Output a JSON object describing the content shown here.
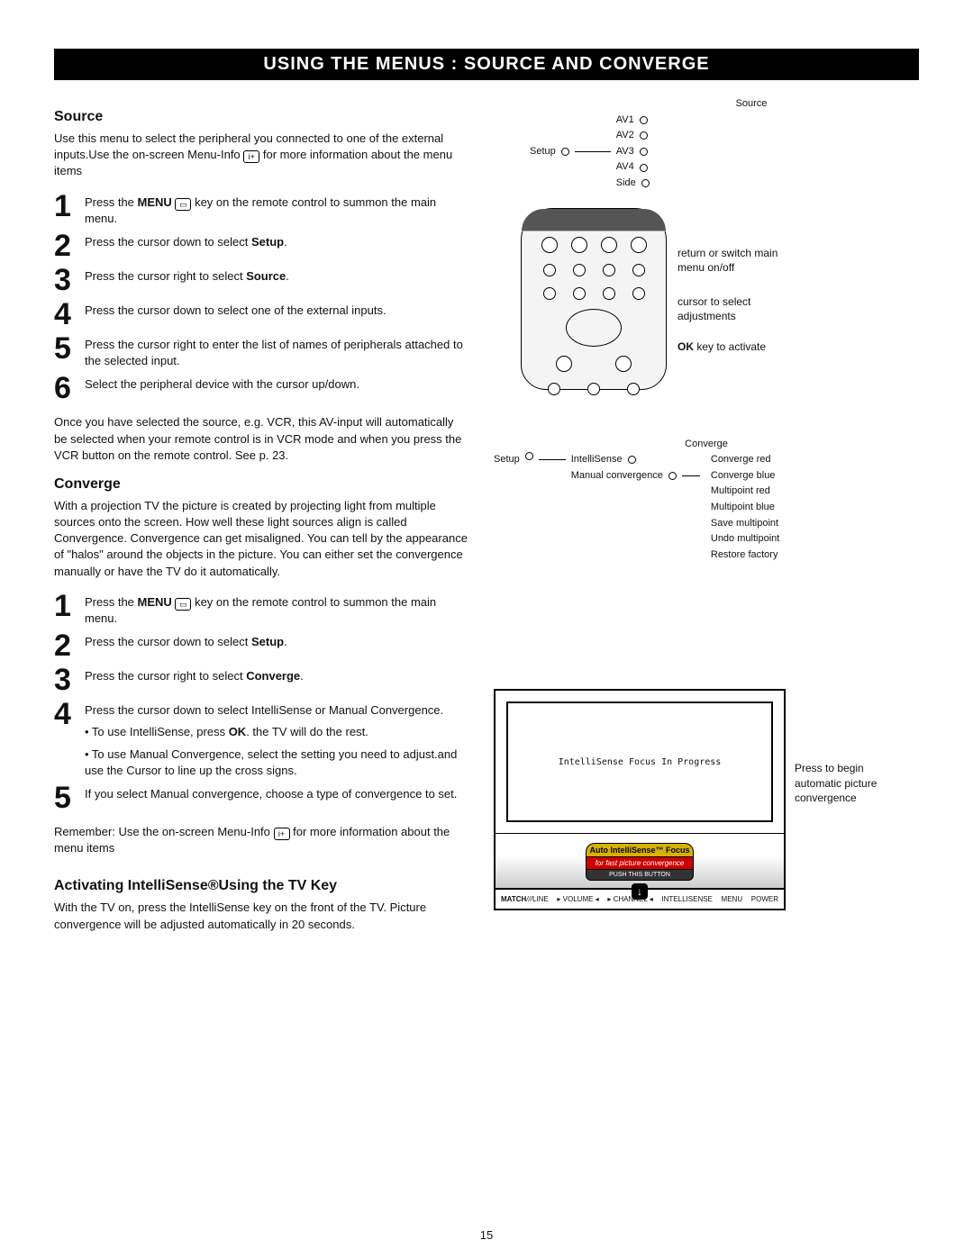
{
  "banner": "USING THE MENUS : SOURCE AND CONVERGE",
  "page_number": "15",
  "source": {
    "heading": "Source",
    "intro_a": "Use this menu  to select the peripheral you connected to one of the external inputs.Use the on-screen Menu-Info ",
    "intro_b": " for more information about the menu items",
    "info_icon": "i+",
    "menu_icon": "▭",
    "steps": [
      {
        "n": "1",
        "pre": "Press the ",
        "bold1": "MENU",
        "mid": " key on the remote control to summon the main menu."
      },
      {
        "n": "2",
        "pre": "Press the cursor down to select ",
        "bold1": "Setup",
        "mid": "."
      },
      {
        "n": "3",
        "pre": "Press the cursor right to select ",
        "bold1": "Source",
        "mid": "."
      },
      {
        "n": "4",
        "pre": "Press the cursor down to select one of the external inputs."
      },
      {
        "n": "5",
        "pre": "Press the cursor right to enter the list of names of peripherals attached to the selected input."
      },
      {
        "n": "6",
        "pre": "Select the peripheral device with the cursor up/down."
      }
    ],
    "after": "Once you have selected the source, e.g. VCR, this AV-input will automatically be selected when your remote control is in VCR mode and when you press the VCR button on the remote control. See p. 23.",
    "tree": {
      "root": "Setup",
      "title": "Source",
      "items": [
        "AV1",
        "AV2",
        "AV3",
        "AV4",
        "Side"
      ]
    }
  },
  "remote_anno": {
    "a": "return or switch main menu on/off",
    "b": "cursor to select adjustments",
    "c_pre": "OK",
    "c_post": " key to activate"
  },
  "converge": {
    "heading": "Converge",
    "intro": "With a projection TV the picture is created by projecting light from multiple sources onto the screen.  How well these light sources align is called Convergence.  Convergence can get misaligned.  You can tell by the appearance of \"halos\" around the objects in the picture. You can either set the convergence manually or have the TV do it automatically.",
    "steps": [
      {
        "n": "1",
        "pre": "Press the ",
        "bold1": "MENU",
        "mid": " key on the remote control to summon the main menu."
      },
      {
        "n": "2",
        "pre": "Press the cursor down to select ",
        "bold1": "Setup",
        "mid": "."
      },
      {
        "n": "3",
        "pre": "Press the cursor right to select ",
        "bold1": "Converge",
        "mid": "."
      },
      {
        "n": "4",
        "pre": "Press the cursor down to select IntelliSense or Manual Convergence."
      }
    ],
    "bul1_pre": "•  To use IntelliSense, press ",
    "bul1_bold": "OK",
    "bul1_post": ".  the TV will do the rest.",
    "bul2": "•  To use Manual Convergence, select the setting you need to adjust.and use the Cursor to line up the cross signs.",
    "step5": {
      "n": "5",
      "text": "If you select Manual convergence, choose a type of convergence to set."
    },
    "after_a": "Remember: Use the on-screen Menu-Info ",
    "after_b": " for more information about the menu items",
    "info_icon": "i+",
    "tree": {
      "root": "Setup",
      "title": "Converge",
      "left": [
        "IntelliSense",
        "Manual convergence"
      ],
      "right": [
        "Converge red",
        "Converge blue",
        "Multipoint red",
        "Multipoint blue",
        "Save multipoint",
        "Undo multipoint",
        "Restore factory"
      ]
    }
  },
  "activating": {
    "heading": "Activating IntelliSense®Using the TV Key",
    "text": "With the TV on, press the IntelliSense key on the front of the TV. Picture convergence will be adjusted automatically in 20 seconds."
  },
  "tv": {
    "screen_text": "IntelliSense Focus In Progress",
    "anno": "Press to begin automatic picture convergence",
    "badge_top": "Auto IntelliSense™ Focus",
    "badge_mid": "for fast picture convergence",
    "badge_bot": "PUSH THIS BUTTON",
    "arrow": "↓",
    "brand": "MATCH",
    "brand2": "LINE",
    "panel_labels": [
      "▸ VOLUME ◂",
      "▸ CHANNEL ◂",
      "INTELLISENSE",
      "MENU",
      "POWER"
    ]
  }
}
